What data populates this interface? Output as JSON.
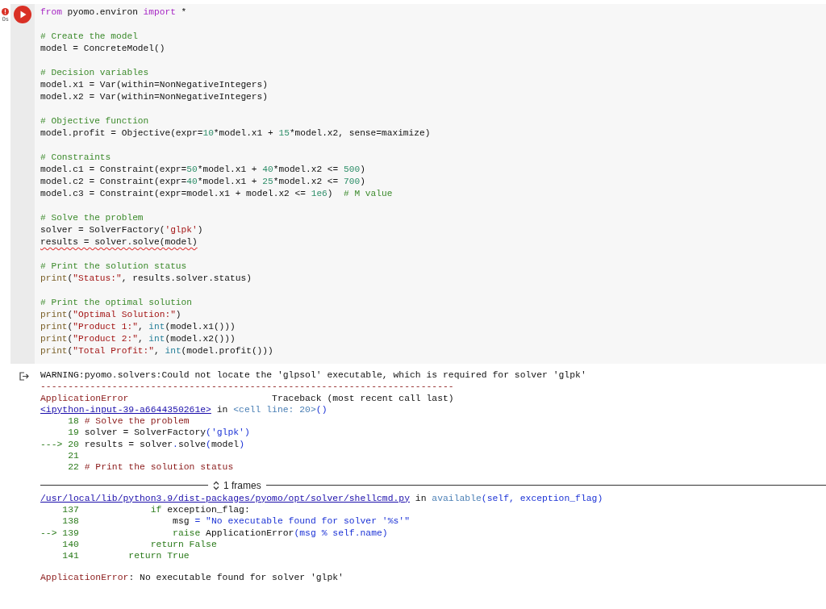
{
  "cell": {
    "error": true,
    "exec_time": "0s",
    "code_blocks": [
      [
        [
          {
            "kind": "kw",
            "text": "from"
          },
          {
            "kind": "plain",
            "text": " pyomo.environ "
          },
          {
            "kind": "kw",
            "text": "import"
          },
          {
            "kind": "plain",
            "text": " *"
          }
        ]
      ],
      [
        [
          {
            "kind": "comment",
            "text": "# Create the model"
          }
        ],
        [
          {
            "kind": "plain",
            "text": "model = ConcreteModel()"
          }
        ]
      ],
      [
        [
          {
            "kind": "comment",
            "text": "# Decision variables"
          }
        ],
        [
          {
            "kind": "plain",
            "text": "model.x1 = Var(within=NonNegativeIntegers)"
          }
        ],
        [
          {
            "kind": "plain",
            "text": "model.x2 = Var(within=NonNegativeIntegers)"
          }
        ]
      ],
      [
        [
          {
            "kind": "comment",
            "text": "# Objective function"
          }
        ],
        [
          {
            "kind": "plain",
            "text": "model.profit = Objective(expr="
          },
          {
            "kind": "num",
            "text": "10"
          },
          {
            "kind": "plain",
            "text": "*model.x1 + "
          },
          {
            "kind": "num",
            "text": "15"
          },
          {
            "kind": "plain",
            "text": "*model.x2, sense=maximize)"
          }
        ]
      ],
      [
        [
          {
            "kind": "comment",
            "text": "# Constraints"
          }
        ],
        [
          {
            "kind": "plain",
            "text": "model.c1 = Constraint(expr="
          },
          {
            "kind": "num",
            "text": "50"
          },
          {
            "kind": "plain",
            "text": "*model.x1 + "
          },
          {
            "kind": "num",
            "text": "40"
          },
          {
            "kind": "plain",
            "text": "*model.x2 <= "
          },
          {
            "kind": "num",
            "text": "500"
          },
          {
            "kind": "plain",
            "text": ")"
          }
        ],
        [
          {
            "kind": "plain",
            "text": "model.c2 = Constraint(expr="
          },
          {
            "kind": "num",
            "text": "40"
          },
          {
            "kind": "plain",
            "text": "*model.x1 + "
          },
          {
            "kind": "num",
            "text": "25"
          },
          {
            "kind": "plain",
            "text": "*model.x2 <= "
          },
          {
            "kind": "num",
            "text": "700"
          },
          {
            "kind": "plain",
            "text": ")"
          }
        ],
        [
          {
            "kind": "plain",
            "text": "model.c3 = Constraint(expr=model.x1 + model.x2 <= "
          },
          {
            "kind": "num",
            "text": "1e6"
          },
          {
            "kind": "plain",
            "text": ")  "
          },
          {
            "kind": "comment",
            "text": "# M value"
          }
        ]
      ],
      [
        [
          {
            "kind": "comment",
            "text": "# Solve the problem"
          }
        ],
        [
          {
            "kind": "plain",
            "text": "solver = SolverFactory("
          },
          {
            "kind": "str",
            "text": "'glpk'"
          },
          {
            "kind": "plain",
            "text": ")"
          }
        ],
        [
          {
            "kind": "squiggle",
            "text": "results = solver.solve(model)"
          }
        ]
      ],
      [
        [
          {
            "kind": "comment",
            "text": "# Print the solution status"
          }
        ],
        [
          {
            "kind": "builtin",
            "text": "print"
          },
          {
            "kind": "plain",
            "text": "("
          },
          {
            "kind": "str",
            "text": "\"Status:\""
          },
          {
            "kind": "plain",
            "text": ", results.solver.status)"
          }
        ]
      ],
      [
        [
          {
            "kind": "comment",
            "text": "# Print the optimal solution"
          }
        ],
        [
          {
            "kind": "builtin",
            "text": "print"
          },
          {
            "kind": "plain",
            "text": "("
          },
          {
            "kind": "str",
            "text": "\"Optimal Solution:\""
          },
          {
            "kind": "plain",
            "text": ")"
          }
        ],
        [
          {
            "kind": "builtin",
            "text": "print"
          },
          {
            "kind": "plain",
            "text": "("
          },
          {
            "kind": "str",
            "text": "\"Product 1:\""
          },
          {
            "kind": "plain",
            "text": ", "
          },
          {
            "kind": "type",
            "text": "int"
          },
          {
            "kind": "plain",
            "text": "(model.x1()))"
          }
        ],
        [
          {
            "kind": "builtin",
            "text": "print"
          },
          {
            "kind": "plain",
            "text": "("
          },
          {
            "kind": "str",
            "text": "\"Product 2:\""
          },
          {
            "kind": "plain",
            "text": ", "
          },
          {
            "kind": "type",
            "text": "int"
          },
          {
            "kind": "plain",
            "text": "(model.x2()))"
          }
        ],
        [
          {
            "kind": "builtin",
            "text": "print"
          },
          {
            "kind": "plain",
            "text": "("
          },
          {
            "kind": "str",
            "text": "\"Total Profit:\""
          },
          {
            "kind": "plain",
            "text": ", "
          },
          {
            "kind": "type",
            "text": "int"
          },
          {
            "kind": "plain",
            "text": "(model.profit()))"
          }
        ]
      ]
    ],
    "output": {
      "lines_before": [
        [
          {
            "kind": "plain",
            "text": "WARNING:pyomo.solvers:Could not locate the 'glpsol' executable, which is required for solver 'glpk'"
          }
        ],
        [
          {
            "kind": "err",
            "text": "---------------------------------------------------------------------------"
          }
        ],
        [
          {
            "kind": "err",
            "text": "ApplicationError"
          },
          {
            "kind": "plain",
            "text": "                          Traceback (most recent call last)"
          }
        ],
        [
          {
            "kind": "link",
            "text": "<ipython-input-39-a6644350261e>"
          },
          {
            "kind": "plain",
            "text": " in "
          },
          {
            "kind": "cyan",
            "text": "<cell line: 20>"
          },
          {
            "kind": "blue",
            "text": "()"
          }
        ],
        [
          {
            "kind": "green",
            "text": "     18 "
          },
          {
            "kind": "err",
            "text": "# Solve the problem"
          }
        ],
        [
          {
            "kind": "green",
            "text": "     19 "
          },
          {
            "kind": "plain",
            "text": "solver = SolverFactory"
          },
          {
            "kind": "blue",
            "text": "('glpk')"
          }
        ],
        [
          {
            "kind": "green",
            "text": "---> 20 "
          },
          {
            "kind": "plain",
            "text": "results = solver"
          },
          {
            "kind": "blue",
            "text": "."
          },
          {
            "kind": "plain",
            "text": "solve"
          },
          {
            "kind": "blue",
            "text": "("
          },
          {
            "kind": "plain",
            "text": "model"
          },
          {
            "kind": "blue",
            "text": ")"
          }
        ],
        [
          {
            "kind": "green",
            "text": "     21"
          }
        ],
        [
          {
            "kind": "green",
            "text": "     22 "
          },
          {
            "kind": "err",
            "text": "# Print the solution status"
          }
        ]
      ],
      "frames_label": "1 frames",
      "lines_after": [
        [
          {
            "kind": "link",
            "text": "/usr/local/lib/python3.9/dist-packages/pyomo/opt/solver/shellcmd.py"
          },
          {
            "kind": "plain",
            "text": " in "
          },
          {
            "kind": "cyan",
            "text": "available"
          },
          {
            "kind": "blue",
            "text": "(self, exception_flag)"
          }
        ],
        [
          {
            "kind": "green",
            "text": "    137             if"
          },
          {
            "kind": "plain",
            "text": " exception_flag:"
          }
        ],
        [
          {
            "kind": "green",
            "text": "    138"
          },
          {
            "kind": "plain",
            "text": "                 msg "
          },
          {
            "kind": "blue",
            "text": "= \"No executable found for solver '%s'\""
          }
        ],
        [
          {
            "kind": "green",
            "text": "--> 139                 raise"
          },
          {
            "kind": "plain",
            "text": " ApplicationError"
          },
          {
            "kind": "blue",
            "text": "(msg % self.name)"
          }
        ],
        [
          {
            "kind": "green",
            "text": "    140             return False"
          }
        ],
        [
          {
            "kind": "green",
            "text": "    141         return True"
          }
        ]
      ],
      "error_summary": [
        {
          "kind": "err",
          "text": "ApplicationError"
        },
        {
          "kind": "plain",
          "text": ": No executable found for solver 'glpk'"
        }
      ]
    }
  }
}
